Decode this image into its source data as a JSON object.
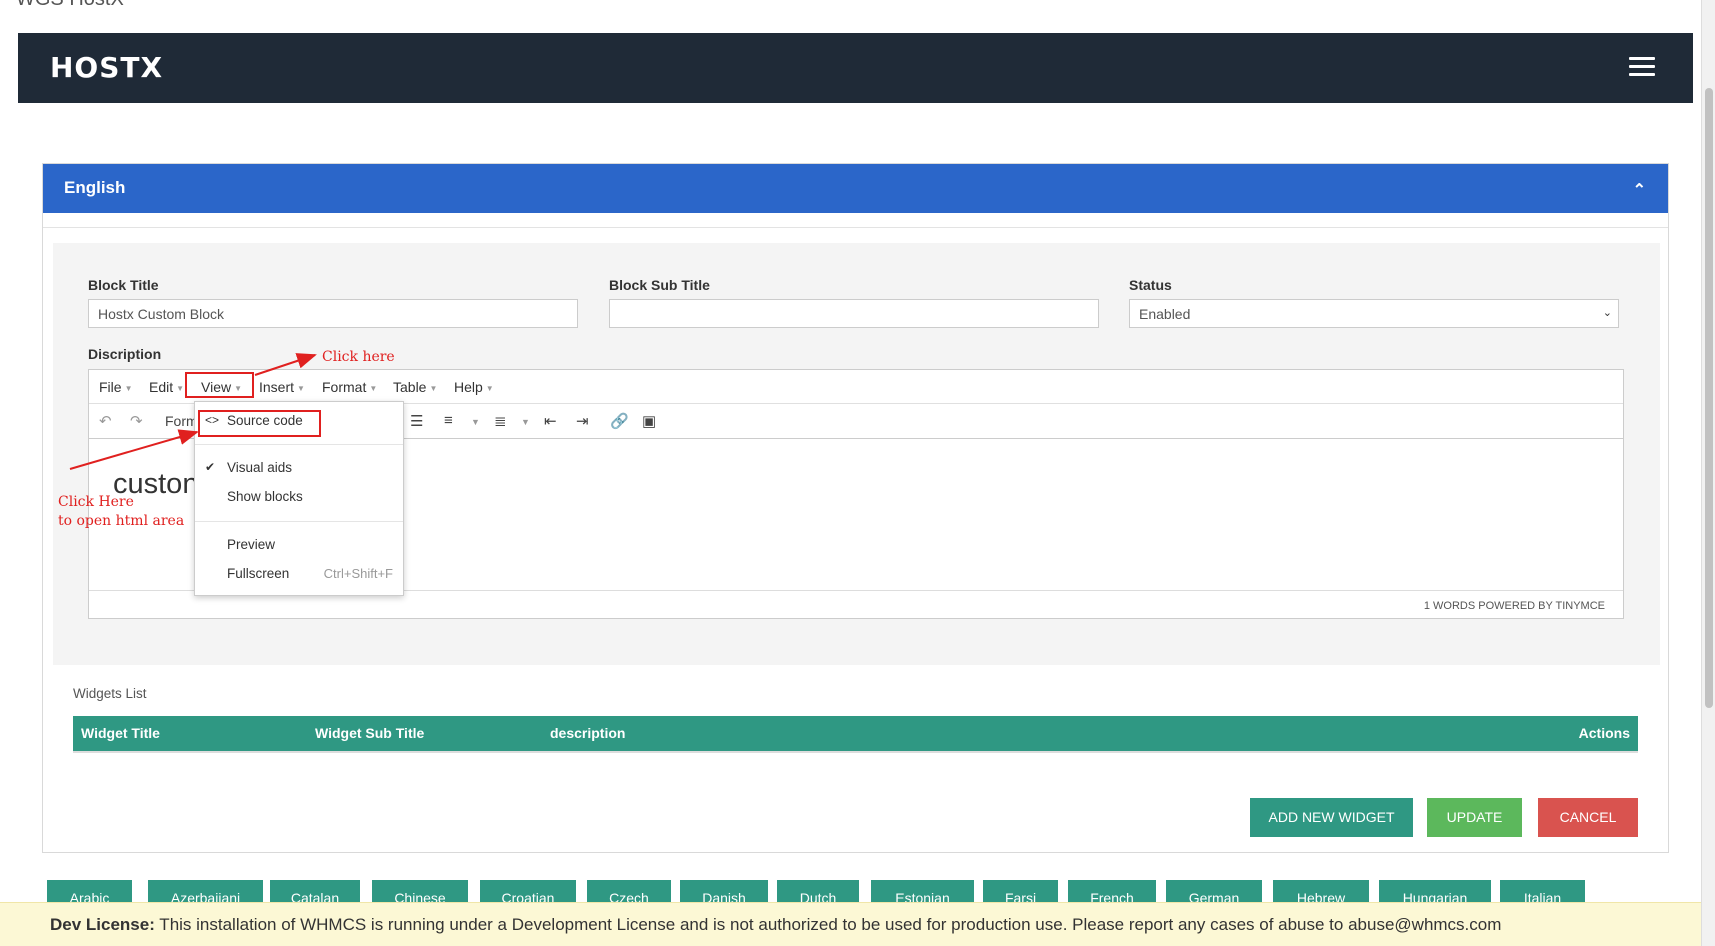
{
  "page": {
    "title": "WGS HostX"
  },
  "header": {
    "logo": "HOSTX",
    "menu_icon": "hamburger-icon"
  },
  "panel": {
    "language": "English",
    "collapse_icon": "chevron-up-icon"
  },
  "form": {
    "block_title_label": "Block Title",
    "block_title_value": "Hostx Custom Block",
    "block_subtitle_label": "Block Sub Title",
    "block_subtitle_value": "",
    "status_label": "Status",
    "status_value": "Enabled",
    "description_label": "Discription"
  },
  "editor": {
    "menu": [
      "File",
      "Edit",
      "View",
      "Insert",
      "Format",
      "Table",
      "Help"
    ],
    "format_label": "Form",
    "content_text": "custon",
    "statusbar": "1 WORDS POWERED BY TINYMCE"
  },
  "view_menu": {
    "source_code": "Source code",
    "visual_aids": "Visual aids",
    "show_blocks": "Show blocks",
    "preview": "Preview",
    "fullscreen": "Fullscreen",
    "fullscreen_shortcut": "Ctrl+Shift+F"
  },
  "annotations": {
    "click_here": "Click here",
    "click_here_open_line1": "Click Here",
    "click_here_open_line2": "to open html area"
  },
  "widgets": {
    "list_label": "Widgets List",
    "columns": [
      "Widget Title",
      "Widget Sub Title",
      "description",
      "Actions"
    ]
  },
  "buttons": {
    "add_widget": "ADD NEW WIDGET",
    "update": "UPDATE",
    "cancel": "CANCEL"
  },
  "languages": [
    "Arabic",
    "Azerbaijani",
    "Catalan",
    "Chinese",
    "Croatian",
    "Czech",
    "Danish",
    "Dutch",
    "Estonian",
    "Farsi",
    "French",
    "German",
    "Hebrew",
    "Hungarian",
    "Italian"
  ],
  "dev_license": {
    "label": "Dev License:",
    "text": " This installation of WHMCS is running under a Development License and is not authorized to be used for production use. Please report any cases of abuse to abuse@whmcs.com"
  },
  "colors": {
    "header": "#1f2a37",
    "panel_head": "#2b66c9",
    "teal": "#2f9883",
    "green": "#5cb85c",
    "red": "#d9534f",
    "annotation": "#e0201f"
  }
}
